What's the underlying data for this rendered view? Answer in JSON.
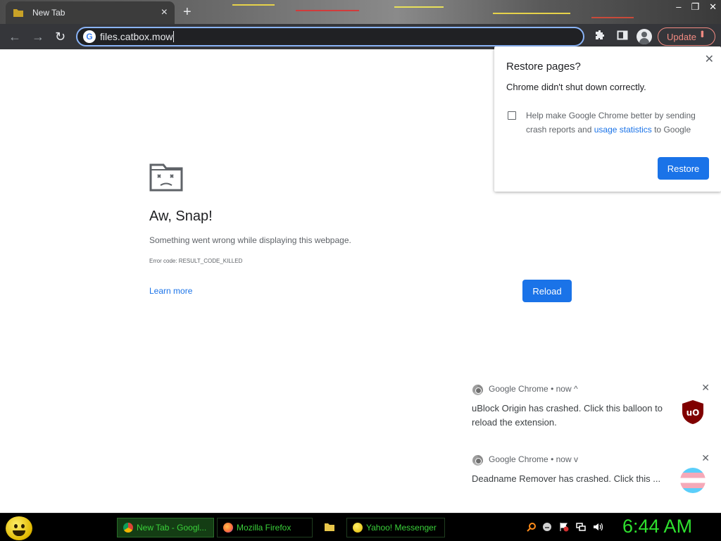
{
  "browser": {
    "tab_title": "New Tab",
    "address": "files.catbox.mow",
    "update_label": "Update"
  },
  "sad_tab": {
    "title": "Aw, Snap!",
    "message": "Something went wrong while displaying this webpage.",
    "error_code": "Error code: RESULT_CODE_KILLED",
    "learn_more": "Learn more",
    "reload_label": "Reload"
  },
  "restore_popup": {
    "title": "Restore pages?",
    "message": "Chrome didn't shut down correctly.",
    "checkbox_text_before": "Help make Google Chrome better by sending crash reports and ",
    "checkbox_link": "usage statistics",
    "checkbox_text_after": " to Google",
    "checkbox_checked": false,
    "restore_label": "Restore"
  },
  "notifications": [
    {
      "app": "Google Chrome",
      "time": "now",
      "chevron": "^",
      "body": "uBlock Origin has crashed. Click this balloon to reload the extension.",
      "icon": "ublock-origin-icon"
    },
    {
      "app": "Google Chrome",
      "time": "now",
      "chevron": "v",
      "body": "Deadname Remover has crashed. Click this ...",
      "icon": "deadname-remover-icon"
    }
  ],
  "taskbar": {
    "tasks": [
      {
        "label": "New Tab - Googl...",
        "active": true
      },
      {
        "label": "Mozilla Firefox",
        "active": false
      },
      {
        "label": "Yahoo! Messenger",
        "active": false
      }
    ],
    "clock": "6:44 AM"
  },
  "colors": {
    "accent_blue": "#1a73e8",
    "omnibox_focus": "#8ab4f8",
    "update_red": "#f28b82",
    "taskbar_green": "#3ad13a",
    "clock_green": "#2ee02e"
  }
}
